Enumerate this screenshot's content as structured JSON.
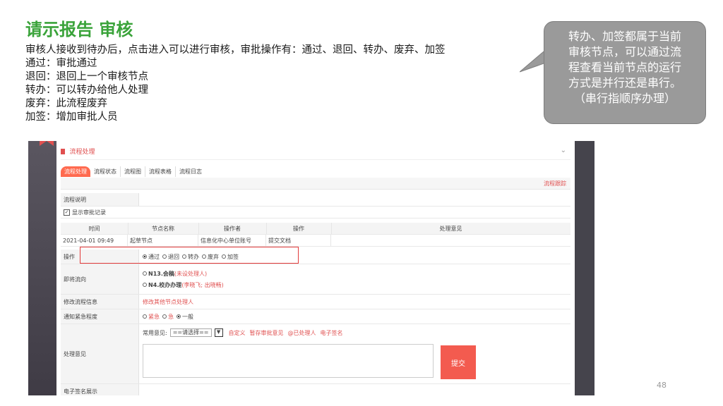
{
  "slide": {
    "title": "请示报告 审核",
    "lines": [
      "审核人接收到待办后，点击进入可以进行审核，审批操作有：通过、退回、转办、废弃、加签",
      "通过：审批通过",
      "退回：退回上一个审核节点",
      "转办：可以转办给他人处理",
      "废弃：此流程废弃",
      "加签：增加审批人员"
    ],
    "callout": {
      "l1": "转办、加签都属于当前",
      "l2": "审核节点，可以通过流",
      "l3": "程查看当前节点的运行",
      "l4": "方式是并行还是串行。",
      "l5": "（串行指顺序办理）"
    },
    "page_number": "48"
  },
  "panel": {
    "title": "流程处理",
    "tabs": [
      "流程处理",
      "流程状态",
      "流程图",
      "流程表格",
      "流程日志"
    ],
    "trace_link": "流程跟踪",
    "description_label": "流程说明",
    "show_records_label": "显示审批记录",
    "record_headers": [
      "时间",
      "节点名称",
      "操作者",
      "操作",
      "处理意见"
    ],
    "record_row": [
      "2021-04-01 09:49",
      "起草节点",
      "信息化中心单位账号",
      "提交文档",
      ""
    ],
    "operation_label": "操作",
    "operations": [
      "通过",
      "退回",
      "转办",
      "废弃",
      "加签"
    ],
    "next_flow_label": "即将流向",
    "next_flow": {
      "n1_name": "N13.会稿",
      "n1_note": "(未设处理人)",
      "n2_name": "N4.校办办理",
      "n2_note": "(李晓飞; 出晓畅)"
    },
    "modify_label": "修改流程信息",
    "modify_link": "修改其他节点处理人",
    "urgency_label": "通知紧急程度",
    "urgency": [
      "紧急",
      "急",
      "一般"
    ],
    "opinion_label": "处理意见",
    "common_opinion_label": "常用意见:",
    "common_opinion_select": "==请选择==",
    "opinion_links": [
      "自定义",
      "暂存审批意见",
      "@已处理人",
      "电子签名"
    ],
    "submit": "提交",
    "signature_label": "电子签名展示"
  },
  "colors": {
    "title_green": "#3aa33a",
    "accent_red": "#e05050",
    "callout_gray": "#9a9a9a"
  }
}
